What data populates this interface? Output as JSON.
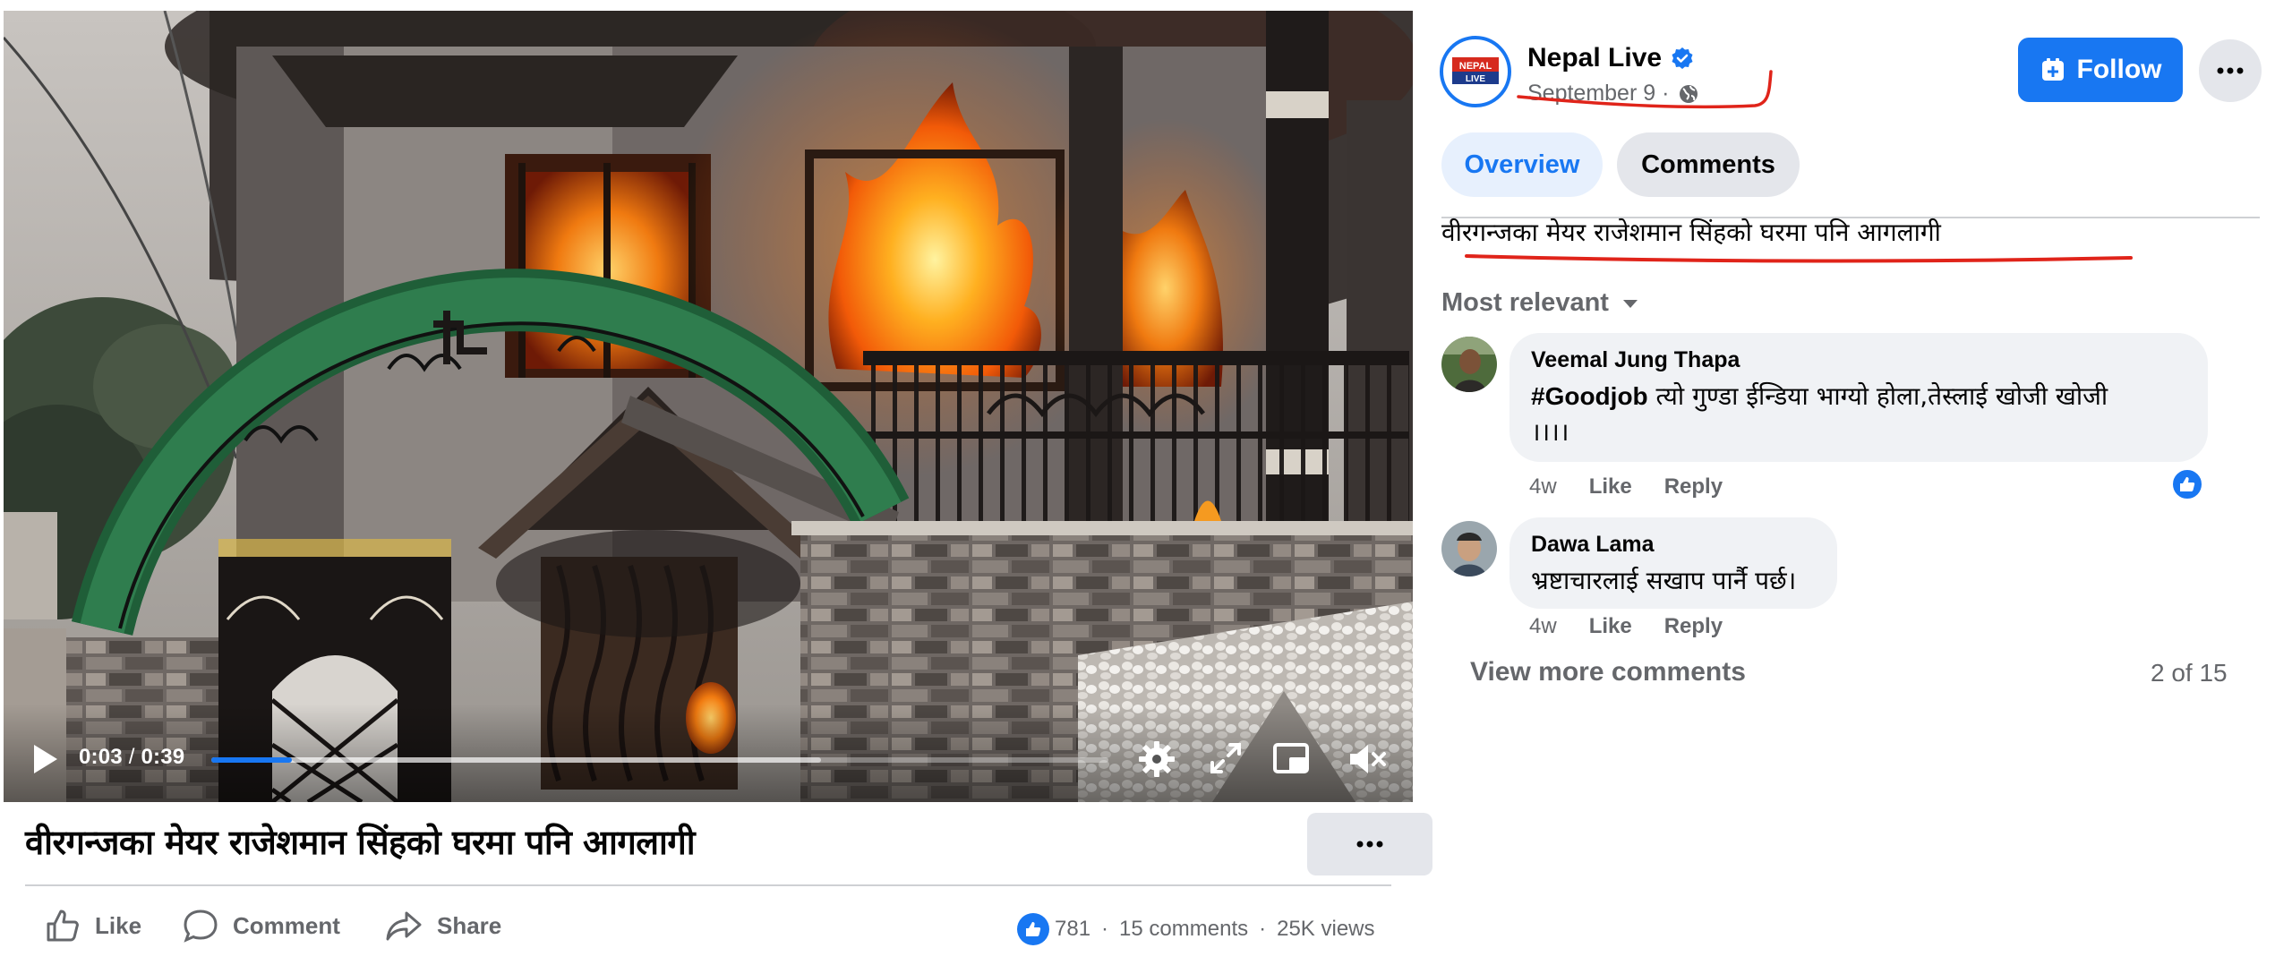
{
  "video": {
    "time_current": "0:03",
    "time_separator": "/",
    "time_total": "0:39",
    "progress_played": 0.09,
    "progress_buffered": 0.68,
    "icons": [
      "play-icon",
      "settings-gear-icon",
      "fullscreen-icon",
      "picture-in-picture-icon",
      "muted-speaker-icon"
    ]
  },
  "post": {
    "title": "वीरगन्जका मेयर राजेशमान सिंहको घरमा पनि आगलागी",
    "actions": {
      "like": "Like",
      "comment": "Comment",
      "share": "Share"
    },
    "stats": {
      "reactions": "781",
      "comments": "15 comments",
      "views": "25K views",
      "dot": "·"
    }
  },
  "page": {
    "name": "Nepal Live",
    "logo_text_top": "NEPAL",
    "logo_text_bottom": "LIVE",
    "date": "September 9 ·",
    "follow_label": "Follow",
    "verified": true
  },
  "tabs": [
    {
      "label": "Overview",
      "active": false
    },
    {
      "label": "Comments",
      "active": true
    }
  ],
  "caption": "वीरगन्जका मेयर राजेशमान सिंहको घरमा पनि आगलागी",
  "comments_section": {
    "sort_label": "Most relevant",
    "view_more": "View more comments",
    "count": "2 of 15"
  },
  "comments": [
    {
      "author": "Veemal Jung Thapa",
      "hashtag": "#Goodjob",
      "text_line1": " त्यो गुण्डा ईन्डिया भाग्यो होला,तेस्लाई खोजी खोजी",
      "text_line2": "।।।।",
      "age": "4w",
      "like": "Like",
      "reply": "Reply",
      "reaction": "like"
    },
    {
      "author": "Dawa Lama",
      "text_line1": "भ्रष्टाचारलाई सखाप पार्नै पर्छ।",
      "age": "4w",
      "like": "Like",
      "reply": "Reply"
    }
  ],
  "colors": {
    "accent": "#1877f2",
    "annotation_red": "#e0241a",
    "secondary_text": "#65676b",
    "bubble": "#f0f2f5"
  }
}
